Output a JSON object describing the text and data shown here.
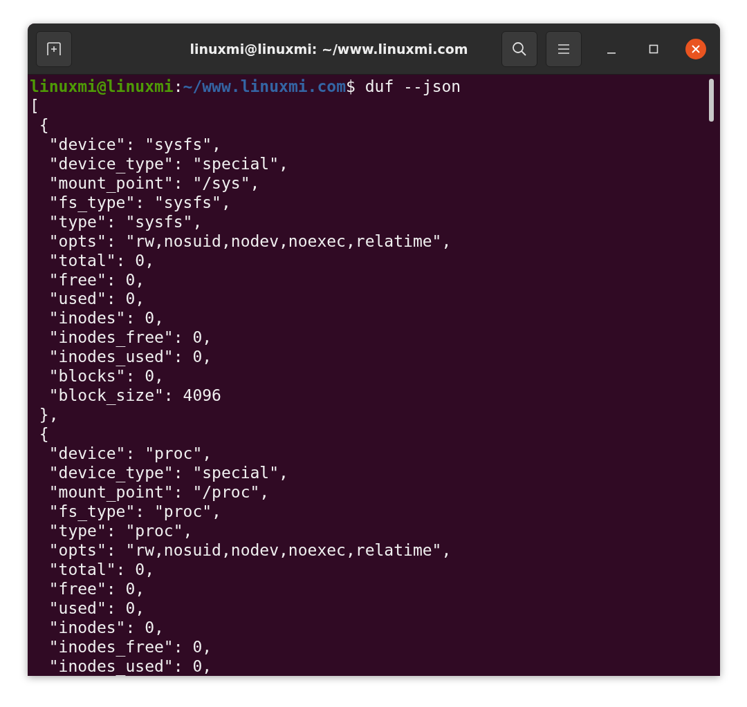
{
  "window": {
    "title": "linuxmi@linuxmi: ~/www.linuxmi.com"
  },
  "prompt": {
    "user": "linuxmi@linuxmi",
    "separator": ":",
    "path": "~/www.linuxmi.com",
    "symbol": "$",
    "command": "duf --json"
  },
  "output_lines": [
    "[",
    " {",
    "  \"device\": \"sysfs\",",
    "  \"device_type\": \"special\",",
    "  \"mount_point\": \"/sys\",",
    "  \"fs_type\": \"sysfs\",",
    "  \"type\": \"sysfs\",",
    "  \"opts\": \"rw,nosuid,nodev,noexec,relatime\",",
    "  \"total\": 0,",
    "  \"free\": 0,",
    "  \"used\": 0,",
    "  \"inodes\": 0,",
    "  \"inodes_free\": 0,",
    "  \"inodes_used\": 0,",
    "  \"blocks\": 0,",
    "  \"block_size\": 4096",
    " },",
    " {",
    "  \"device\": \"proc\",",
    "  \"device_type\": \"special\",",
    "  \"mount_point\": \"/proc\",",
    "  \"fs_type\": \"proc\",",
    "  \"type\": \"proc\",",
    "  \"opts\": \"rw,nosuid,nodev,noexec,relatime\",",
    "  \"total\": 0,",
    "  \"free\": 0,",
    "  \"used\": 0,",
    "  \"inodes\": 0,",
    "  \"inodes_free\": 0,",
    "  \"inodes_used\": 0,"
  ]
}
